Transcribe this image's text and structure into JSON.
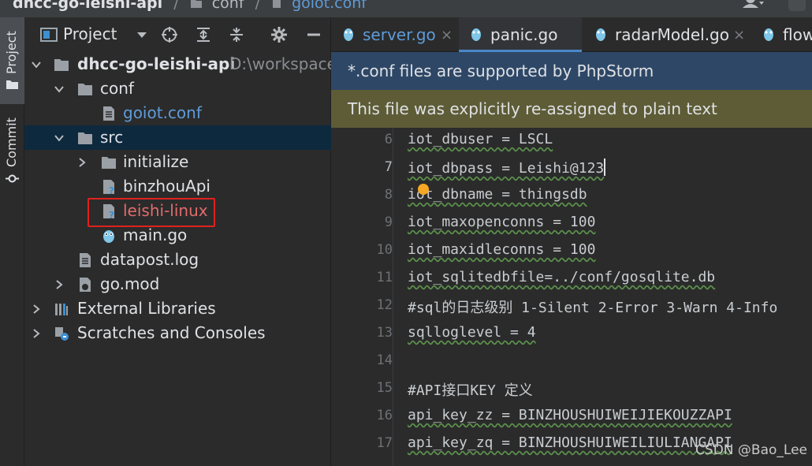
{
  "breadcrumb": {
    "project": "dhcc-go-leishi-api",
    "sep1": "/",
    "dir": "conf",
    "sep2": "/",
    "file": "goiot.conf"
  },
  "tool_strip": {
    "project_label": "Project",
    "commit_label": "Commit"
  },
  "project_pane": {
    "title": "Project"
  },
  "tree": [
    {
      "label": "dhcc-go-leishi-api",
      "path": "D:\\workspace"
    },
    {
      "label": "conf"
    },
    {
      "label": "goiot.conf"
    },
    {
      "label": "src"
    },
    {
      "label": "initialize"
    },
    {
      "label": "binzhouApi"
    },
    {
      "label": "leishi-linux"
    },
    {
      "label": "main.go"
    },
    {
      "label": "datapost.log"
    },
    {
      "label": "go.mod"
    },
    {
      "label": "External Libraries"
    },
    {
      "label": "Scratches and Consoles"
    }
  ],
  "tabs": [
    {
      "label": "server.go",
      "close": "×"
    },
    {
      "label": "panic.go"
    },
    {
      "label": "radarModel.go",
      "close": "×"
    },
    {
      "label": "flow"
    }
  ],
  "banners": {
    "support": "*.conf files are supported by PhpStorm",
    "reassigned": "This file was explicitly re-assigned to plain text"
  },
  "code_lines": [
    {
      "n": "6",
      "text": "iot_dbuser = LSCL"
    },
    {
      "n": "7",
      "text": "iot_dbpass = Leishi@123"
    },
    {
      "n": "8",
      "text": "iot_dbname = thingsdb"
    },
    {
      "n": "9",
      "text": "iot_maxopenconns = 100"
    },
    {
      "n": "10",
      "text": "iot_maxidleconns = 100"
    },
    {
      "n": "11",
      "text": "iot_sqlitedbfile=../conf/gosqlite.db"
    },
    {
      "n": "12",
      "text": "#sql的日志级别 1-Silent 2-Error 3-Warn 4-Info"
    },
    {
      "n": "13",
      "text": "sqlloglevel = 4"
    },
    {
      "n": "14",
      "text": ""
    },
    {
      "n": "15",
      "text": "#API接口KEY 定义"
    },
    {
      "n": "16",
      "text": "api_key_zz = BINZHOUSHUIWEIJIEKOUZZAPI"
    },
    {
      "n": "17",
      "text": "api_key_zq = BINZHOUSHUIWEILIULIANGAPI"
    }
  ],
  "watermark": "CSDN @Bao_Lee",
  "colors": {
    "accent": "#4a88c7",
    "highlight_box": "#e0211d",
    "file_blue": "#5e9bd8",
    "unknown_file_red": "#e06c6c"
  }
}
